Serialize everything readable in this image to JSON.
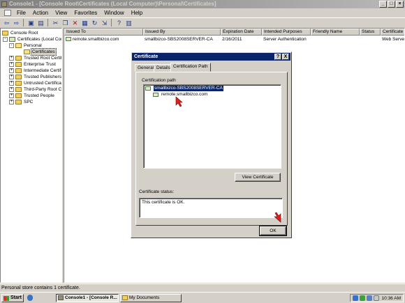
{
  "window": {
    "title": "Console1 - [Console Root\\Certificates (Local Computer)\\Personal\\Certificates]"
  },
  "menu": [
    "File",
    "Action",
    "View",
    "Favorites",
    "Window",
    "Help"
  ],
  "tree": {
    "items": [
      {
        "label": "Console Root",
        "expander": ""
      },
      {
        "label": "Certificates (Local Com",
        "expander": "-"
      },
      {
        "label": "Personal",
        "expander": "-"
      },
      {
        "label": "Certificates",
        "expander": ""
      },
      {
        "label": "Trusted Root Certif",
        "expander": "+"
      },
      {
        "label": "Enterprise Trust",
        "expander": "+"
      },
      {
        "label": "Intermediate Certif",
        "expander": "+"
      },
      {
        "label": "Trusted Publishers",
        "expander": "+"
      },
      {
        "label": "Untrusted Certifica",
        "expander": "+"
      },
      {
        "label": "Third-Party Root C",
        "expander": "+"
      },
      {
        "label": "Trusted People",
        "expander": "+"
      },
      {
        "label": "SPC",
        "expander": "+"
      }
    ]
  },
  "list": {
    "columns": [
      "Issued To",
      "Issued By",
      "Expiration Date",
      "Intended Purposes",
      "Friendly Name",
      "Status",
      "Certificate T"
    ],
    "rows": [
      [
        "remote.smallbizco.com",
        "smallbizco-SBS2008SERVER-CA",
        "2/16/2011",
        "Server Authentication",
        "",
        "",
        "Web Server"
      ]
    ]
  },
  "statusbar": {
    "text": "Personal store contains 1 certificate."
  },
  "dialog": {
    "title": "Certificate",
    "help_btn": "?",
    "close_btn": "X",
    "tabs": [
      "General",
      "Details",
      "Certification Path"
    ],
    "path_label": "Certification path",
    "path": [
      "smallbizco-SBS2008SERVER-CA",
      "remote.smallbizco.com"
    ],
    "view_cert_btn": "View Certificate",
    "status_label": "Certificate status:",
    "status_text": "This certificate is OK.",
    "ok_btn": "OK"
  },
  "taskbar": {
    "start": "Start",
    "buttons": [
      "Console1 - [Console R...",
      "My Documents"
    ],
    "time": "10:36 AM"
  },
  "colors": {
    "dialog_title": "#0a246a",
    "face": "#d4d0c8",
    "cursor": "#e02020"
  }
}
